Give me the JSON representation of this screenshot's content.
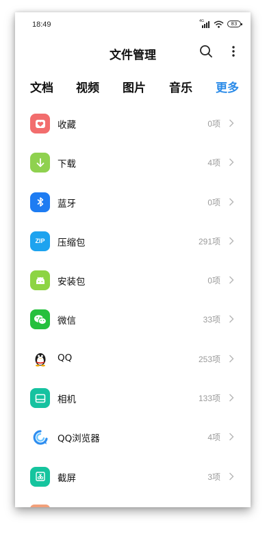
{
  "status_bar": {
    "time": "18:49",
    "network_label": "4G",
    "battery": "83"
  },
  "app_bar": {
    "title": "文件管理",
    "search_icon": "search-icon",
    "more_icon": "more-vertical-icon"
  },
  "tabs": [
    {
      "label": "文档",
      "active": false
    },
    {
      "label": "视频",
      "active": false
    },
    {
      "label": "图片",
      "active": false
    },
    {
      "label": "音乐",
      "active": false
    },
    {
      "label": "更多",
      "active": true
    }
  ],
  "accent_color": "#2b8be8",
  "items": [
    {
      "label": "收藏",
      "count": "0项",
      "icon": "favorite-icon",
      "color": "#f26d6d"
    },
    {
      "label": "下载",
      "count": "4项",
      "icon": "download-icon",
      "color": "#8fd14f"
    },
    {
      "label": "蓝牙",
      "count": "0项",
      "icon": "bluetooth-icon",
      "color": "#1e7cf2"
    },
    {
      "label": "压缩包",
      "count": "291项",
      "icon": "zip-icon",
      "icon_text": "ZIP",
      "color": "#1da3ef"
    },
    {
      "label": "安装包",
      "count": "0项",
      "icon": "android-icon",
      "color": "#8dd443"
    },
    {
      "label": "微信",
      "count": "33项",
      "icon": "wechat-icon",
      "color": "#25c03d"
    },
    {
      "label": "QQ",
      "count": "253项",
      "icon": "qq-penguin-icon",
      "color": "#ffffff"
    },
    {
      "label": "相机",
      "count": "133项",
      "icon": "camera-icon",
      "color": "#16c2a0"
    },
    {
      "label": "QQ浏览器",
      "count": "4项",
      "icon": "qq-browser-icon",
      "color": "#ffffff"
    },
    {
      "label": "截屏",
      "count": "3项",
      "icon": "screenshot-icon",
      "color": "#15c49e"
    }
  ]
}
